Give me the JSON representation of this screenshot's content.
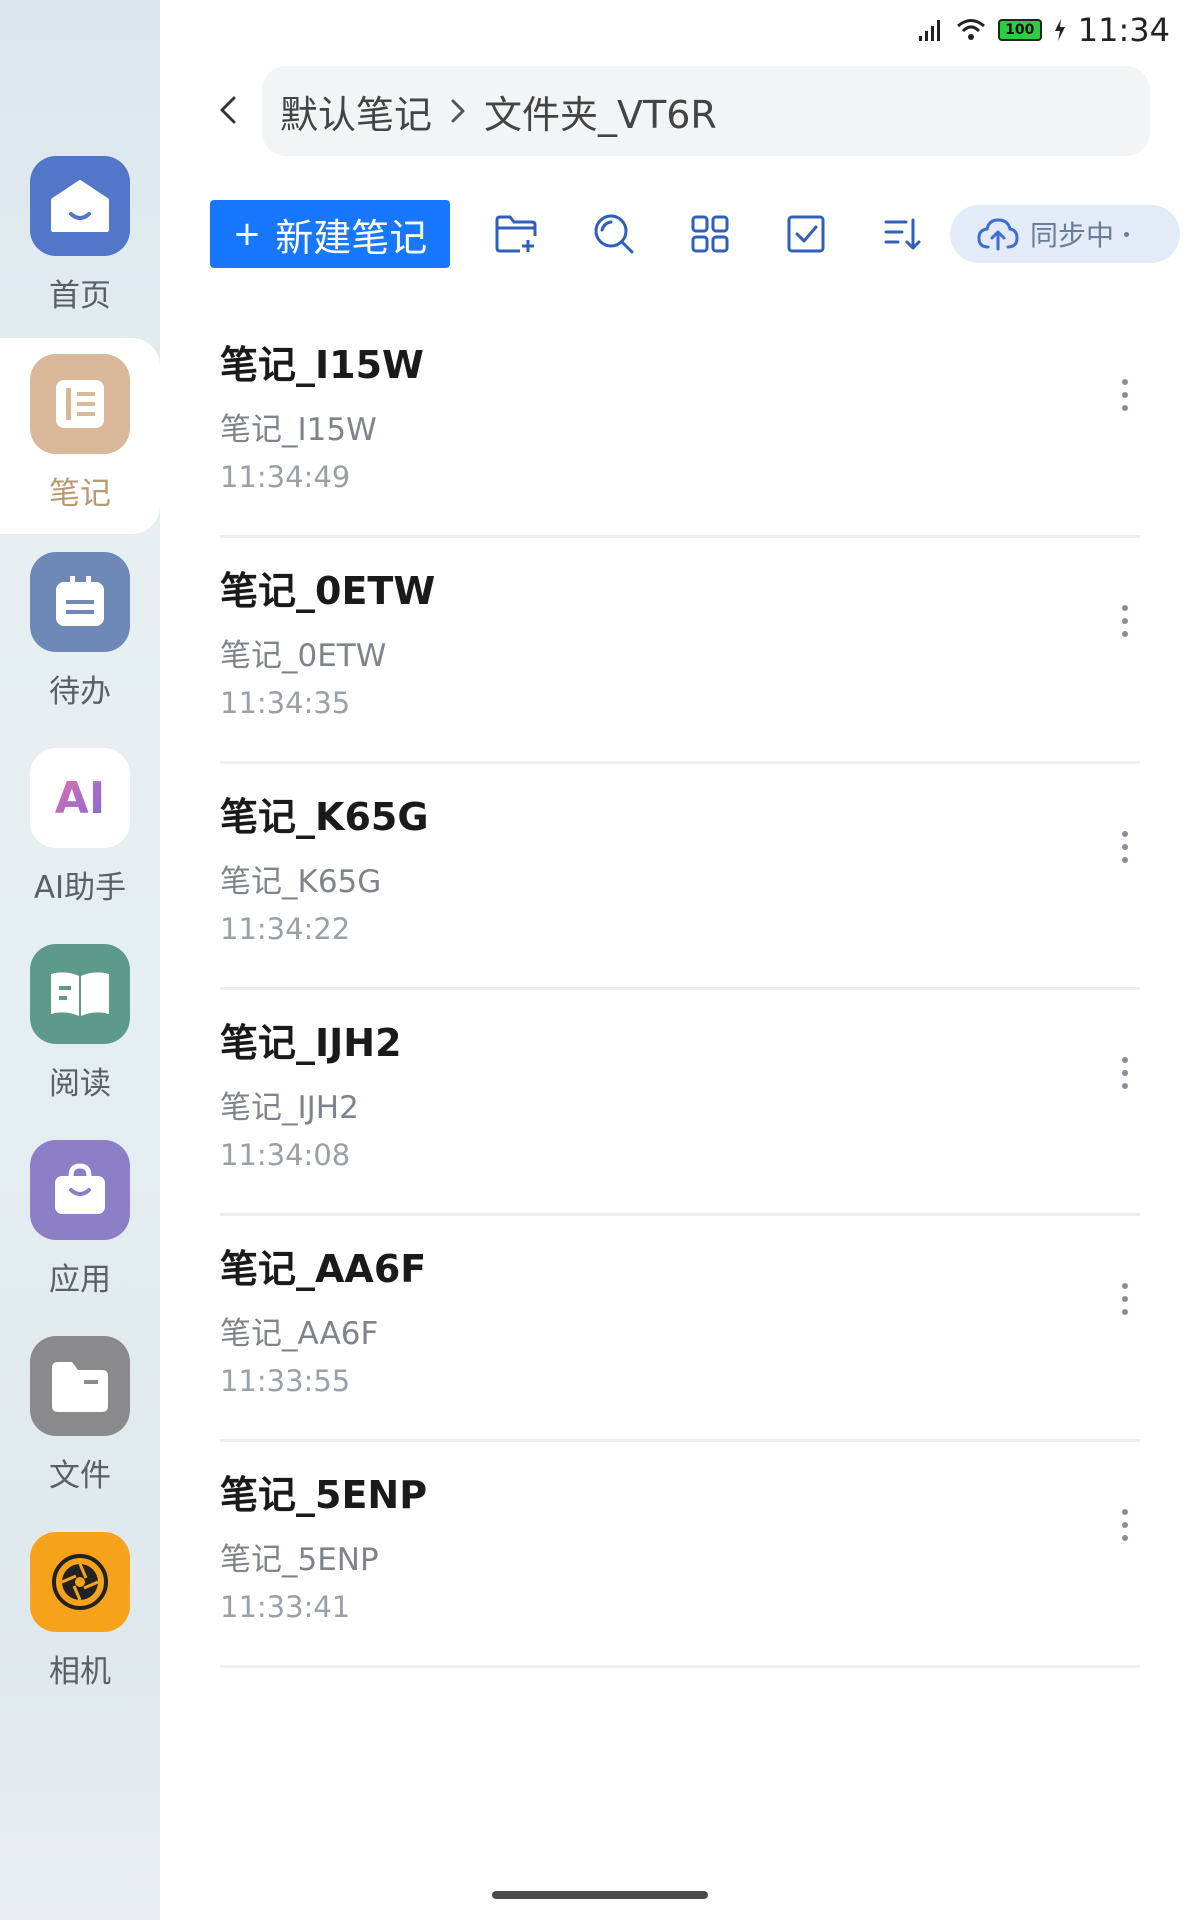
{
  "status": {
    "time": "11:34",
    "battery": "100"
  },
  "sidebar": {
    "items": [
      {
        "label": "首页",
        "icon": "home-icon"
      },
      {
        "label": "笔记",
        "icon": "notebook-icon",
        "active": true
      },
      {
        "label": "待办",
        "icon": "calendar-icon"
      },
      {
        "label": "AI助手",
        "icon": "ai-icon",
        "icon_text": "AI"
      },
      {
        "label": "阅读",
        "icon": "book-icon"
      },
      {
        "label": "应用",
        "icon": "bag-icon"
      },
      {
        "label": "文件",
        "icon": "folder-icon"
      },
      {
        "label": "相机",
        "icon": "camera-icon"
      }
    ]
  },
  "header": {
    "breadcrumb": [
      "默认笔记",
      "文件夹_VT6R"
    ]
  },
  "toolbar": {
    "new_note_label": "新建笔记",
    "sync_label": "同步中",
    "accent": "#1778ff"
  },
  "notes": [
    {
      "title": "笔记_I15W",
      "preview": "笔记_I15W",
      "time": "11:34:49"
    },
    {
      "title": "笔记_0ETW",
      "preview": "笔记_0ETW",
      "time": "11:34:35"
    },
    {
      "title": "笔记_K65G",
      "preview": "笔记_K65G",
      "time": "11:34:22"
    },
    {
      "title": "笔记_IJH2",
      "preview": "笔记_IJH2",
      "time": "11:34:08"
    },
    {
      "title": "笔记_AA6F",
      "preview": "笔记_AA6F",
      "time": "11:33:55"
    },
    {
      "title": "笔记_5ENP",
      "preview": "笔记_5ENP",
      "time": "11:33:41"
    }
  ]
}
